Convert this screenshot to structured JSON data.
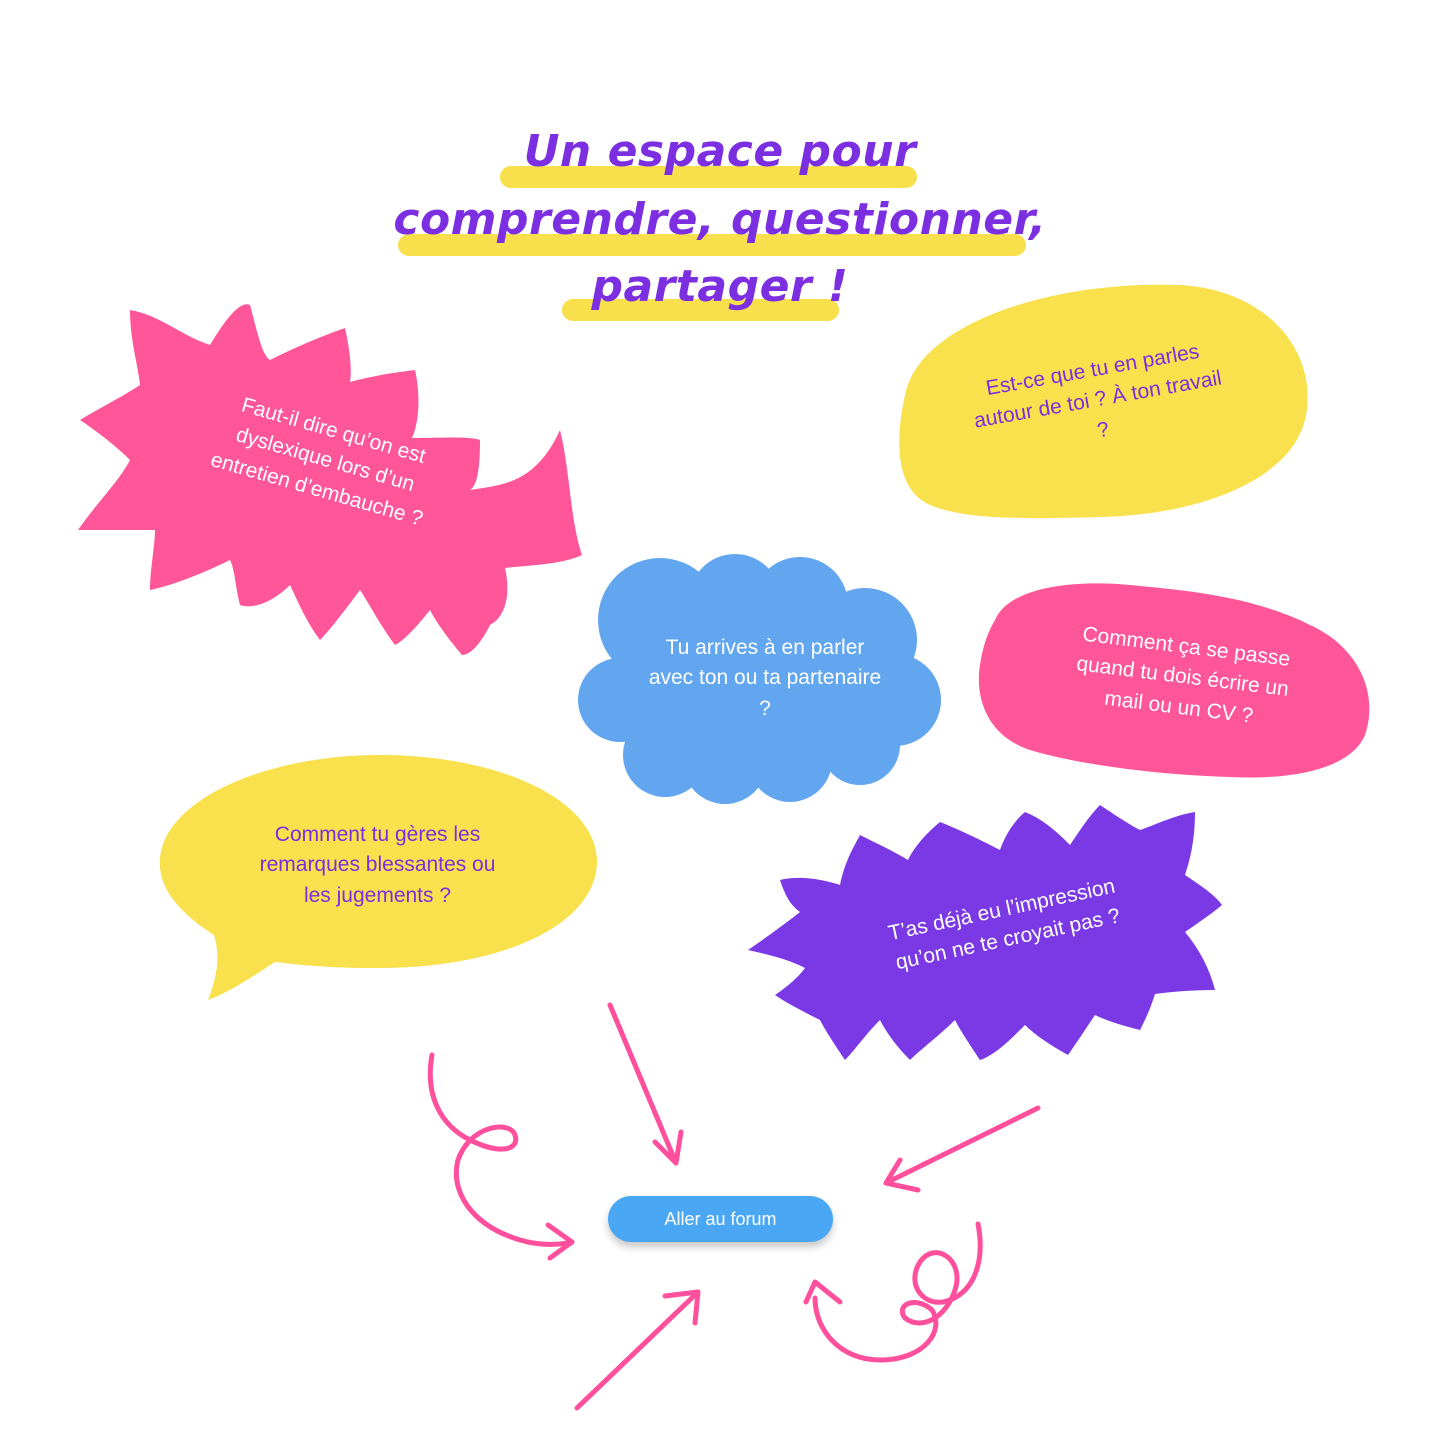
{
  "title": {
    "line1": "Un espace pour",
    "line2": "comprendre, questionner,",
    "line3": "partager !"
  },
  "bubbles": {
    "pink_left": "Faut-il dire qu’on est dyslexique lors d’un entretien d’embauche ?",
    "yellow_right": "Est-ce que tu en parles autour de toi ? À ton travail ?",
    "blue_cloud": "Tu arrives à en parler avec ton ou ta partenaire ?",
    "pink_right": "Comment ça se passe quand tu dois écrire un mail ou un CV ?",
    "yellow_left": "Comment tu gères les remarques blessantes ou les jugements ?",
    "purple_right": "T’as déjà eu l’impression qu’on ne te croyait pas ?"
  },
  "cta": {
    "label": "Aller au forum"
  },
  "colors": {
    "pink": "#ff5599",
    "yellow": "#f8e14c",
    "blue": "#62a6ef",
    "purple": "#7b39e5",
    "title": "#7b2fe0",
    "button": "#4aa7f3",
    "arrow": "#ff4f9d"
  },
  "icons": [
    "curly-arrow-icon",
    "straight-arrow-icon",
    "loop-arrow-icon"
  ]
}
